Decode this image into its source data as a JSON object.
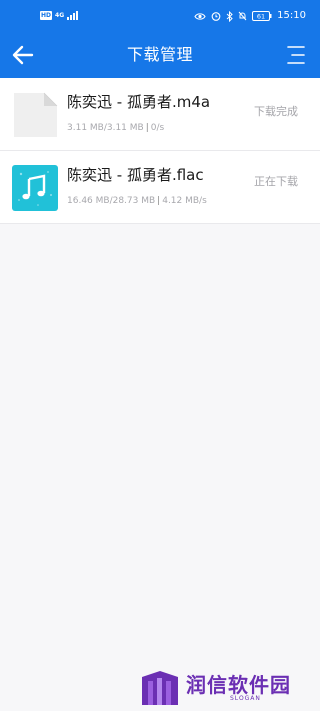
{
  "status_bar": {
    "hd_badge": "HD",
    "network": "4G",
    "time": "15:10",
    "battery": "61"
  },
  "header": {
    "title": "下载管理"
  },
  "downloads": [
    {
      "name": "陈奕迅 - 孤勇者.m4a",
      "progress_text": "3.11 MB/3.11 MB",
      "speed": "0/s",
      "status": "下载完成",
      "icon": "generic-file-icon"
    },
    {
      "name": "陈奕迅 - 孤勇者.flac",
      "progress_text": "16.46 MB/28.73 MB",
      "speed": "4.12 MB/s",
      "status": "正在下载",
      "icon": "music-file-icon"
    }
  ],
  "watermark": {
    "text": "润信软件园",
    "slogan": "SLOGAN"
  },
  "colors": {
    "primary": "#1677e8",
    "music_thumb": "#21c1d8",
    "watermark": "#6b2fb3"
  }
}
